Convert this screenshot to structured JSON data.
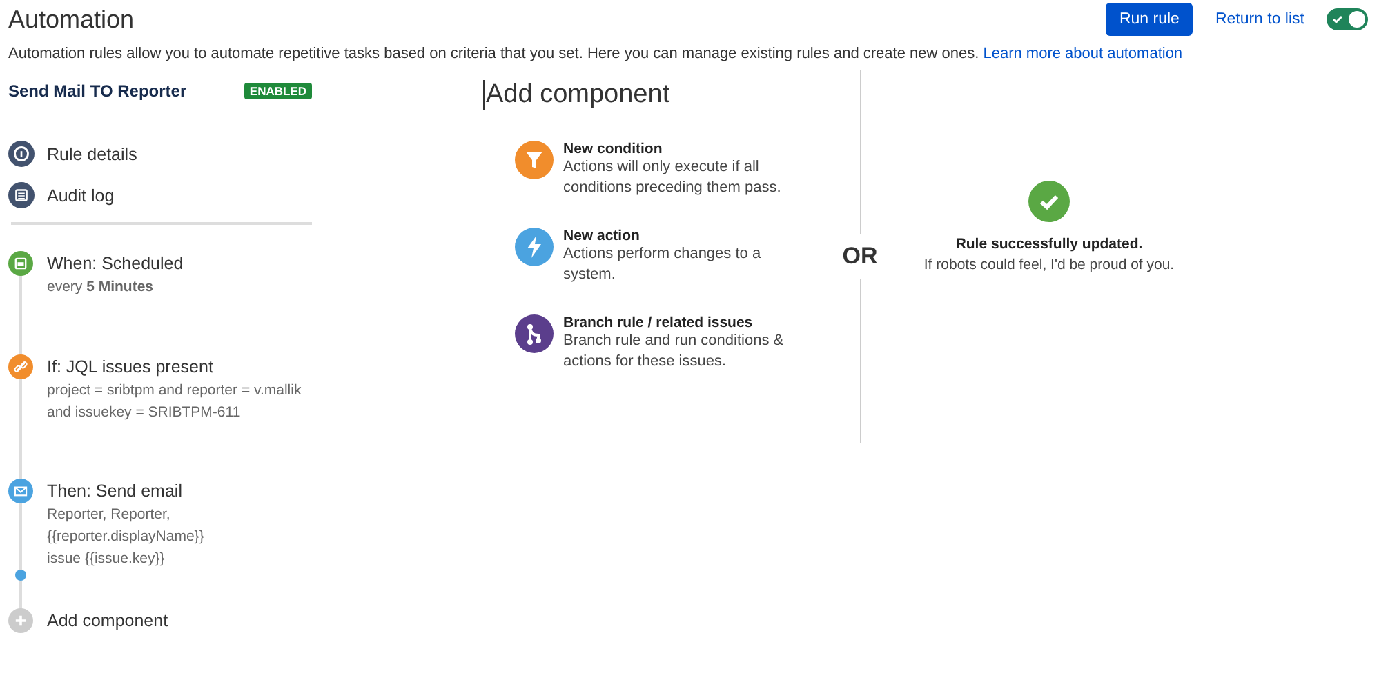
{
  "header": {
    "title": "Automation",
    "run_button": "Run rule",
    "return_link": "Return to list",
    "toggle": {
      "on": true
    }
  },
  "description": {
    "text": "Automation rules allow you to automate repetitive tasks based on criteria that you set. Here you can manage existing rules and create new ones.",
    "link": "Learn more about automation"
  },
  "rule": {
    "name": "Send Mail TO Reporter",
    "status": "ENABLED"
  },
  "nav": [
    {
      "kind": "details",
      "label": "Rule details"
    },
    {
      "kind": "audit",
      "label": "Audit log"
    }
  ],
  "steps": [
    {
      "kind": "schedule",
      "title": "When: Scheduled",
      "detail": [
        "every **5 Minutes**"
      ]
    },
    {
      "kind": "jql",
      "title": "If: JQL issues present",
      "detail": [
        "project = sribtpm and reporter = v.mallik",
        "and issuekey = SRIBTPM-611"
      ]
    },
    {
      "kind": "email",
      "title": "Then: Send email",
      "detail": [
        "Reporter, Reporter,",
        "{{reporter.displayName}}",
        "issue {{issue.key}}"
      ]
    }
  ],
  "add_step": "Add component",
  "panel": {
    "title": "Add component",
    "options": [
      {
        "kind": "condition",
        "title": "New condition",
        "text": "Actions will only execute if all conditions preceding them pass."
      },
      {
        "kind": "action",
        "title": "New action",
        "text": "Actions perform changes to a system."
      },
      {
        "kind": "branch",
        "title": "Branch rule / related issues",
        "text": "Branch rule and run conditions & actions for these issues."
      }
    ]
  },
  "separator": "OR",
  "success": {
    "title": "Rule successfully updated.",
    "text": "If robots could feel, I'd be proud of you."
  }
}
